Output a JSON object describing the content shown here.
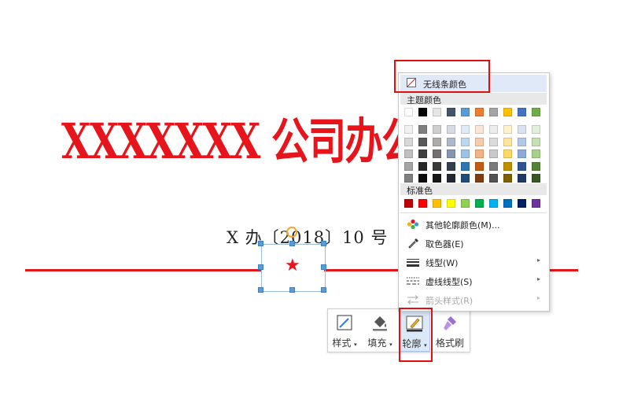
{
  "document": {
    "title": "XXXXXXX 公司办公",
    "doc_number": "X 办〔2018〕10 号",
    "shape_star": "★"
  },
  "toolbar": {
    "style_label": "样式",
    "fill_label": "填充",
    "outline_label": "轮廓",
    "format_painter_label": "格式刷"
  },
  "outline_menu": {
    "no_line_color": "无线条颜色",
    "theme_colors_label": "主题颜色",
    "standard_colors_label": "标准色",
    "theme_top_row": [
      "#ffffff",
      "#000000",
      "#e7e6e6",
      "#44546a",
      "#5b9bd5",
      "#ed7d31",
      "#a5a5a5",
      "#ffc000",
      "#4472c4",
      "#70ad47"
    ],
    "theme_shades": [
      [
        "#f2f2f2",
        "#7f7f7f",
        "#d0cece",
        "#d6dce4",
        "#deebf6",
        "#fbe5d5",
        "#ededed",
        "#fff2cc",
        "#dae3f3",
        "#e2efd9"
      ],
      [
        "#d8d8d8",
        "#595959",
        "#aeabab",
        "#adb9ca",
        "#bdd7ee",
        "#f7cbac",
        "#dbdbdb",
        "#fee599",
        "#b4c6e7",
        "#c5e0b3"
      ],
      [
        "#bfbfbf",
        "#3f3f3f",
        "#757070",
        "#8496b0",
        "#9cc3e5",
        "#f4b183",
        "#c9c9c9",
        "#ffd965",
        "#8eaadb",
        "#a8d08d"
      ],
      [
        "#a5a5a5",
        "#262626",
        "#3a3838",
        "#323f4f",
        "#2e75b5",
        "#c55a11",
        "#7b7b7b",
        "#bf9000",
        "#2f5496",
        "#538135"
      ],
      [
        "#7f7f7f",
        "#0c0c0c",
        "#171616",
        "#222a35",
        "#1e4e79",
        "#833c0b",
        "#525252",
        "#7f6000",
        "#1f3864",
        "#375623"
      ]
    ],
    "standard_row": [
      "#c00000",
      "#ff0000",
      "#ffc000",
      "#ffff00",
      "#92d050",
      "#00b050",
      "#00b0f0",
      "#0070c0",
      "#002060",
      "#7030a0"
    ],
    "more_colors": "其他轮廓颜色(M)...",
    "eyedropper": "取色器(E)",
    "line_style": "线型(W)",
    "dash_style": "虚线线型(S)",
    "arrow_style": "箭头样式(R)",
    "submenu_arrow": "▸"
  },
  "colors": {
    "title_red": "#e8141b",
    "highlight_red": "#e01010",
    "menu_hover": "#dfe9f7"
  }
}
